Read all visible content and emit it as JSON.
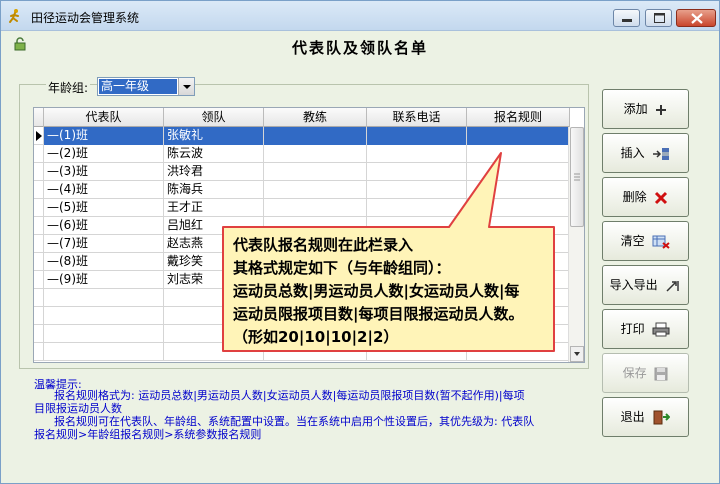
{
  "window": {
    "title": "田径运动会管理系统",
    "heading": "代表队及领队名单"
  },
  "filter": {
    "age_label": "年龄组:",
    "age_value": "高一年级"
  },
  "table": {
    "columns": [
      "代表队",
      "领队",
      "教练",
      "联系电话",
      "报名规则"
    ],
    "rows": [
      {
        "team": "—(1)班",
        "leader": "张敏礼"
      },
      {
        "team": "—(2)班",
        "leader": "陈云波"
      },
      {
        "team": "—(3)班",
        "leader": "洪玲君"
      },
      {
        "team": "—(4)班",
        "leader": "陈海兵"
      },
      {
        "team": "—(5)班",
        "leader": "王才正"
      },
      {
        "team": "—(6)班",
        "leader": "吕旭红"
      },
      {
        "team": "—(7)班",
        "leader": "赵志燕"
      },
      {
        "team": "—(8)班",
        "leader": "戴珍笑"
      },
      {
        "team": "—(9)班",
        "leader": "刘志荣"
      }
    ]
  },
  "callout": {
    "lines": [
      "代表队报名规则在此栏录入",
      "其格式规定如下（与年龄组同）：",
      "运动员总数|男运动员人数|女运动员人数|每",
      "运动员限报项目数|每项目限报运动员人数。",
      "（形如20|10|10|2|2）"
    ]
  },
  "tips": {
    "title": "温馨提示:",
    "lines": [
      "报名规则格式为: 运动员总数|男运动员人数|女运动员人数|每运动员限报项目数(暂不起作用)|每项",
      "目限报运动员人数",
      "报名规则可在代表队、年龄组、系统配置中设置。当在系统中启用个性设置后，其优先级为: 代表队",
      "报名规则>年龄组报名规则>系统参数报名规则"
    ]
  },
  "buttons": {
    "add": "添加",
    "insert": "插入",
    "delete": "删除",
    "clear": "清空",
    "import_export": "导入导出",
    "print": "打印",
    "save": "保存",
    "exit": "退出"
  },
  "colors": {
    "selection": "#316ac5",
    "callout_fill": "#fff4b8",
    "callout_border": "#e04040",
    "tip_text": "#0000cc"
  }
}
